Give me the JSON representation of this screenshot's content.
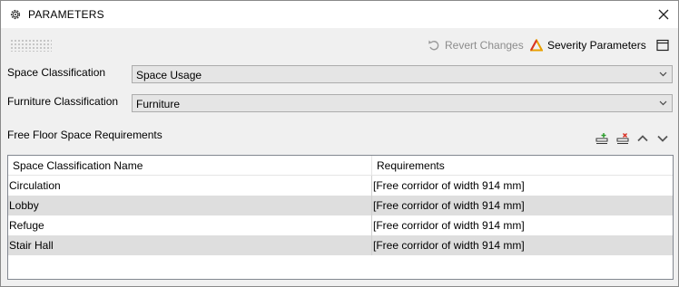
{
  "window": {
    "title": "PARAMETERS",
    "title_icon": "gear-icon",
    "close_icon": "close-icon"
  },
  "toolbar": {
    "revert_label": "Revert Changes",
    "severity_label": "Severity Parameters",
    "severity_color": "#e8a000"
  },
  "space_classification": {
    "label": "Space Classification",
    "value": "Space Usage"
  },
  "furniture_classification": {
    "label": "Furniture Classification",
    "value": "Furniture"
  },
  "requirements": {
    "label": "Free Floor Space Requirements",
    "columns": [
      "Space Classification Name",
      "Requirements"
    ],
    "rows": [
      {
        "name": "Circulation",
        "requirement": "[Free corridor of width 914 mm]"
      },
      {
        "name": "Lobby",
        "requirement": "[Free corridor of width 914 mm]"
      },
      {
        "name": "Refuge",
        "requirement": "[Free corridor of width 914 mm]"
      },
      {
        "name": "Stair Hall",
        "requirement": "[Free corridor of width 914 mm]"
      }
    ]
  }
}
